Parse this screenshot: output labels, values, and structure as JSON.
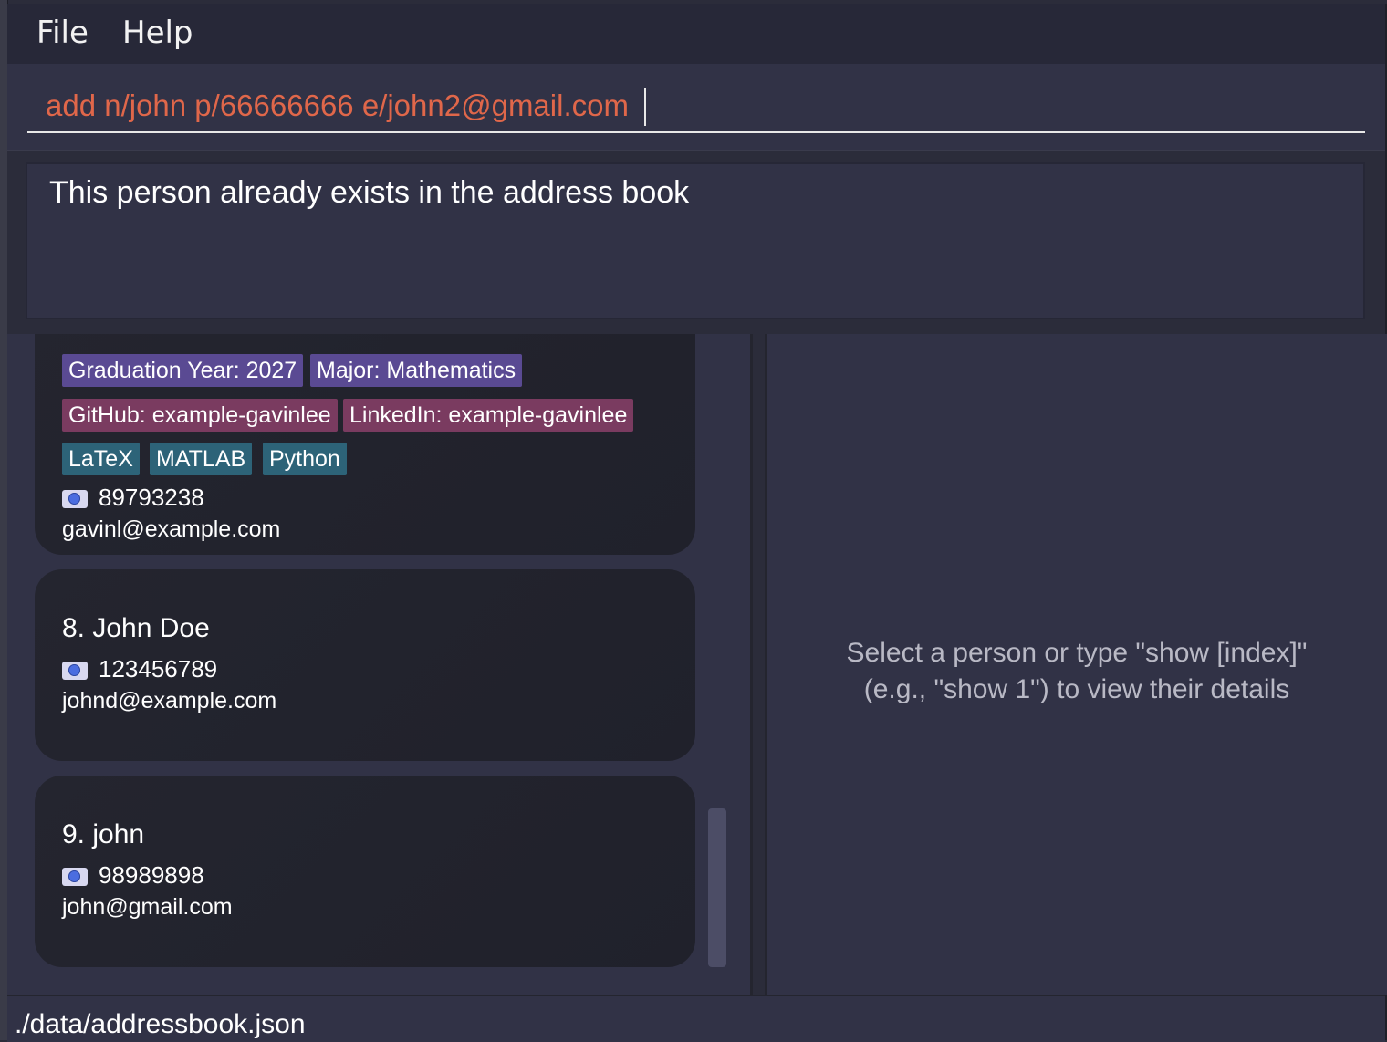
{
  "menu": {
    "file": "File",
    "help": "Help"
  },
  "command": {
    "value": "add n/john p/66666666 e/john2@gmail.com"
  },
  "result": {
    "message": "This person already exists in the address book"
  },
  "people": [
    {
      "tags_row1": [
        "Graduation Year: 2027",
        "Major: Mathematics"
      ],
      "tags_row2": [
        "GitHub: example-gavinlee",
        "LinkedIn: example-gavinlee"
      ],
      "tags_row3": [
        "LaTeX",
        "MATLAB",
        "Python"
      ],
      "phone": "89793238",
      "email": "gavinl@example.com"
    },
    {
      "name": "8. John Doe",
      "phone": "123456789",
      "email": "johnd@example.com"
    },
    {
      "name": "9. john",
      "phone": "98989898",
      "email": "john@gmail.com"
    }
  ],
  "detail": {
    "hint_line1": "Select a person or type \"show [index]\"",
    "hint_line2": "(e.g., \"show 1\") to view their details"
  },
  "status": {
    "path": "./data/addressbook.json"
  },
  "colors": {
    "command_text": "#e0674a",
    "tag_purple": "#5a4a93",
    "tag_pink": "#7a3b60",
    "tag_teal": "#2d6378"
  }
}
